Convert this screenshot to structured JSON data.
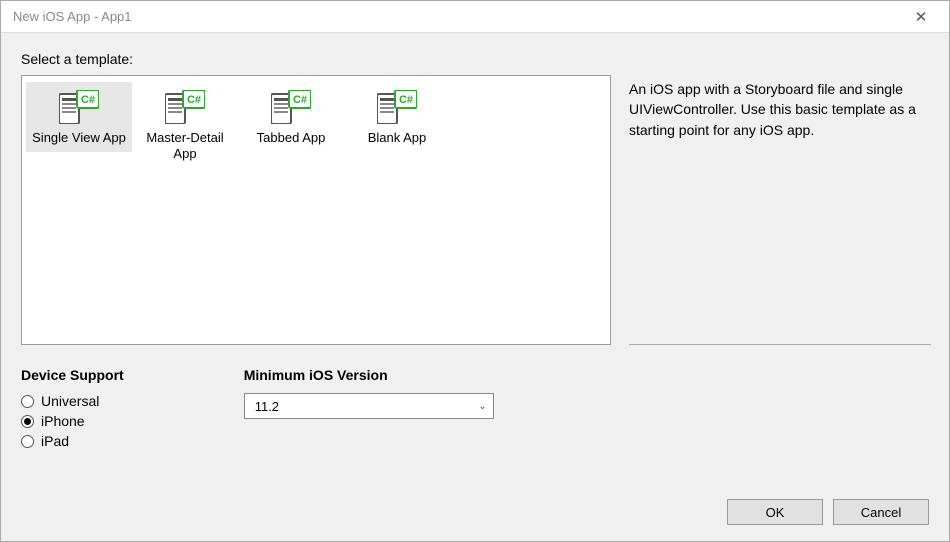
{
  "window": {
    "title": "New iOS App - App1"
  },
  "prompt": "Select a template:",
  "templates": [
    {
      "label": "Single View App",
      "selected": true
    },
    {
      "label": "Master-Detail App",
      "selected": false
    },
    {
      "label": "Tabbed App",
      "selected": false
    },
    {
      "label": "Blank App",
      "selected": false
    }
  ],
  "description": "An iOS app with a Storyboard file and single UIViewController. Use this basic template as a starting point for any iOS app.",
  "deviceSupport": {
    "title": "Device Support",
    "options": [
      {
        "label": "Universal",
        "checked": false
      },
      {
        "label": "iPhone",
        "checked": true
      },
      {
        "label": "iPad",
        "checked": false
      }
    ]
  },
  "minIos": {
    "title": "Minimum iOS Version",
    "value": "11.2"
  },
  "buttons": {
    "ok": "OK",
    "cancel": "Cancel"
  }
}
